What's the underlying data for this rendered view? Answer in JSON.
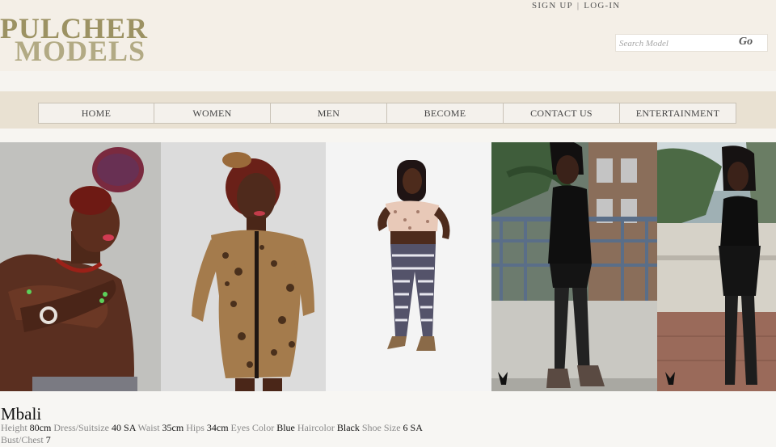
{
  "brand": {
    "line1": "PULCHER",
    "line2": "MODELS"
  },
  "toplinks": {
    "signup": "SIGN UP",
    "separator": "|",
    "login": "LOG-IN"
  },
  "search": {
    "placeholder": "Search Model",
    "go": "Go"
  },
  "nav": [
    "HOME",
    "WOMEN",
    "MEN",
    "BECOME",
    "CONTACT US",
    "ENTERTAINMENT"
  ],
  "model": {
    "name": "Mbali",
    "stats": [
      {
        "label": "Height",
        "value": "80cm"
      },
      {
        "label": "Dress/Suitsize",
        "value": "40 SA"
      },
      {
        "label": "Waist",
        "value": "35cm"
      },
      {
        "label": "Hips",
        "value": "34cm"
      },
      {
        "label": "Eyes Color",
        "value": "Blue"
      },
      {
        "label": "Haircolor",
        "value": "Black"
      },
      {
        "label": "Shoe Size",
        "value": "6 SA"
      },
      {
        "label": "Bust/Chest",
        "value": "7"
      }
    ]
  },
  "colors": {
    "header_bg": "#f4efe7",
    "logo_dark": "#9c9263",
    "logo_light": "#b2aa84",
    "nav_bar": "#e9e1d2",
    "nav_button": "#f4f1ec"
  }
}
